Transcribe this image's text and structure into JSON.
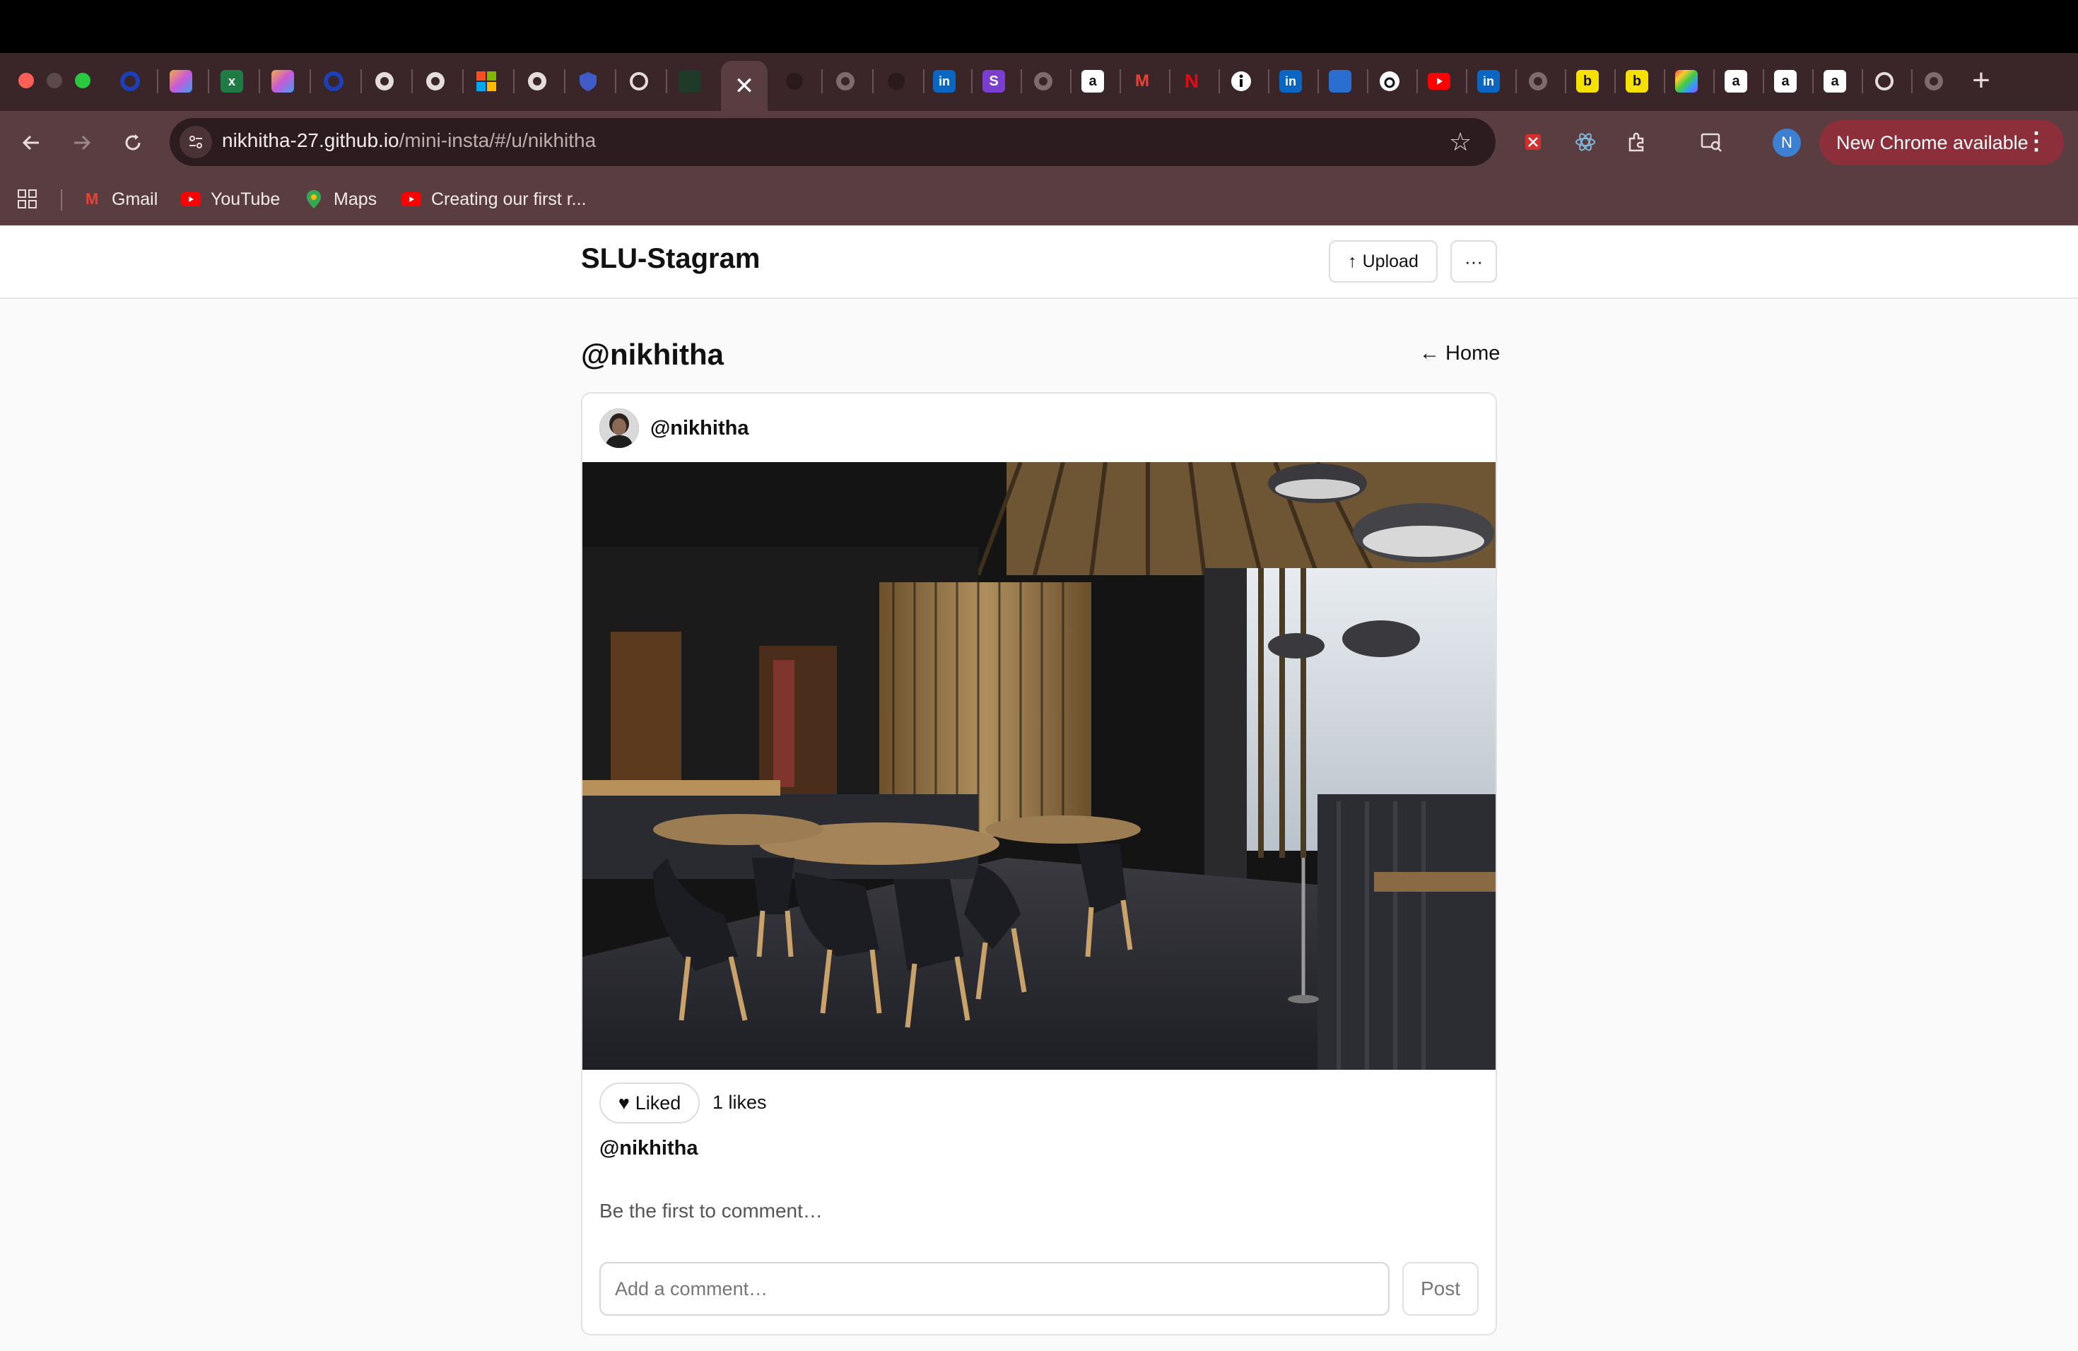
{
  "browser": {
    "active_tab_close": "✕",
    "new_tab": "+",
    "url_host": "nikhitha-27.github.io",
    "url_path": "/mini-insta/#/u/nikhitha",
    "profile_initial": "N",
    "update_label": "New Chrome available",
    "bookmarks": [
      {
        "label": "Gmail",
        "icon": "gmail-icon",
        "color": "#ea4335"
      },
      {
        "label": "YouTube",
        "icon": "youtube-icon",
        "color": "#ff0000"
      },
      {
        "label": "Maps",
        "icon": "maps-icon",
        "color": "#34a853"
      },
      {
        "label": "Creating our first r...",
        "icon": "youtube-icon",
        "color": "#ff0000"
      }
    ]
  },
  "app": {
    "brand": "SLU-Stagram",
    "upload_label": "Upload",
    "upload_icon": "↑",
    "more_label": "···"
  },
  "profile": {
    "title": "@nikhitha",
    "home_link": "← Home"
  },
  "post": {
    "username": "@nikhitha",
    "image_desc": "restaurant-interior-photo",
    "like_icon": "♥",
    "like_label": "Liked",
    "likes": "1 likes",
    "caption_user": "@nikhitha",
    "empty_comments": "Be the first to comment…",
    "comment_placeholder": "Add a comment…",
    "post_button": "Post"
  },
  "colors": {
    "tabstrip": "#3a2528",
    "toolbar": "#5a3d41",
    "update_button": "#8c2f3a",
    "page_bg": "#fafafa"
  }
}
